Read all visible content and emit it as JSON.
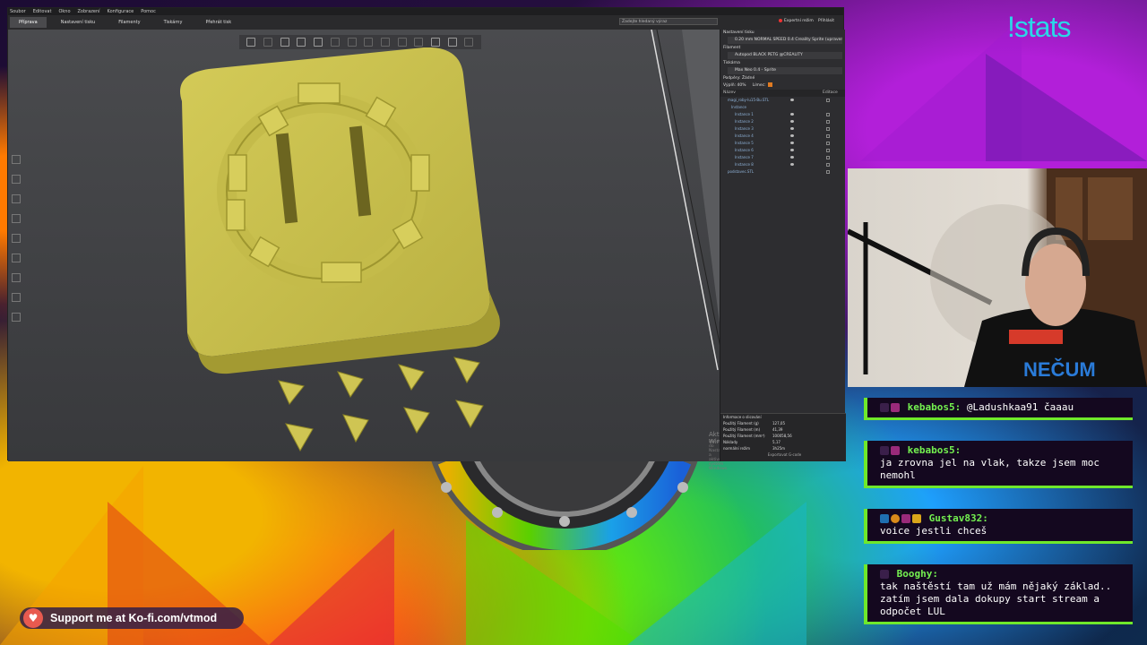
{
  "menubar": [
    "Soubor",
    "Editovat",
    "Okno",
    "Zobrazení",
    "Konfigurace",
    "Pomoc"
  ],
  "tabs": [
    {
      "label": "Příprava",
      "active": true
    },
    {
      "label": "Nastavení tisku",
      "active": false
    },
    {
      "label": "Filamenty",
      "active": false
    },
    {
      "label": "Tiskárny",
      "active": false
    },
    {
      "label": "Přehrát tisk",
      "active": false
    }
  ],
  "search": {
    "placeholder": "Zadejte hledaný výraz"
  },
  "expert_mode": "Expertní režim",
  "login": "Přihlásit",
  "panel": {
    "print_settings_label": "Nastavení tisku",
    "print_settings_value": "0.20 mm NORMAL SPEED 0.4 Creality Sprite (upraveno)",
    "filament_label": "Filament",
    "filament_value": "Autopod BLACK PETG @CREALITY",
    "printer_label": "Tiskárna",
    "printer_value": "Max Neo 0.4 - Sprite",
    "supports_label": "Podpěry:",
    "supports_value": "Žádné",
    "infill_label": "Výplň:",
    "infill_value": "40%",
    "brim_label": "Límec:",
    "list_header_name": "Název",
    "list_header_edit": "Editace",
    "objects": [
      "magi_roby-lu15-Bu.STL",
      "Instance",
      "Instance 1",
      "Instance 2",
      "Instance 3",
      "Instance 4",
      "Instance 5",
      "Instance 6",
      "Instance 7",
      "Instance 8",
      "podstavec.STL"
    ],
    "info_title": "Informace o slicování",
    "info_rows": [
      {
        "label": "Použitý Filament (g)",
        "value": "127,05"
      },
      {
        "label": "Použitý Filament (m)",
        "value": "41,39"
      },
      {
        "label": "Použitý Filament (mm³)",
        "value": "100058,56"
      },
      {
        "label": "Náklady",
        "value": "5,17"
      },
      {
        "label": "normální režim",
        "value": "3h25m"
      }
    ],
    "export_label": "Exportovat G-code"
  },
  "watermark": {
    "title": "Aktivovat Windows",
    "sub": "Přejděte do Nastavení a aktivujte systém Windows."
  },
  "overlay": {
    "stats": "!stats",
    "kofi": "Support me at Ko-fi.com/vtmod"
  },
  "chat": [
    {
      "user": "kebabos5:",
      "text": "@Ladushkaa91 čaaau",
      "inline": true
    },
    {
      "user": "kebabos5:",
      "text": "ja zrovna jel na vlak, takze jsem moc nemohl",
      "inline": false
    },
    {
      "user": "Gustav832:",
      "text": "voice jestli chceš",
      "inline": false
    },
    {
      "user": "Booghy:",
      "text": "tak naštěstí tam už mám nějaký základ.. zatím jsem dala dokupy start stream a odpočet LUL",
      "inline": false
    }
  ],
  "colors": {
    "model": "#c6bd4a",
    "chat_border": "#6fe82b",
    "stats": "#2ad7e8"
  }
}
